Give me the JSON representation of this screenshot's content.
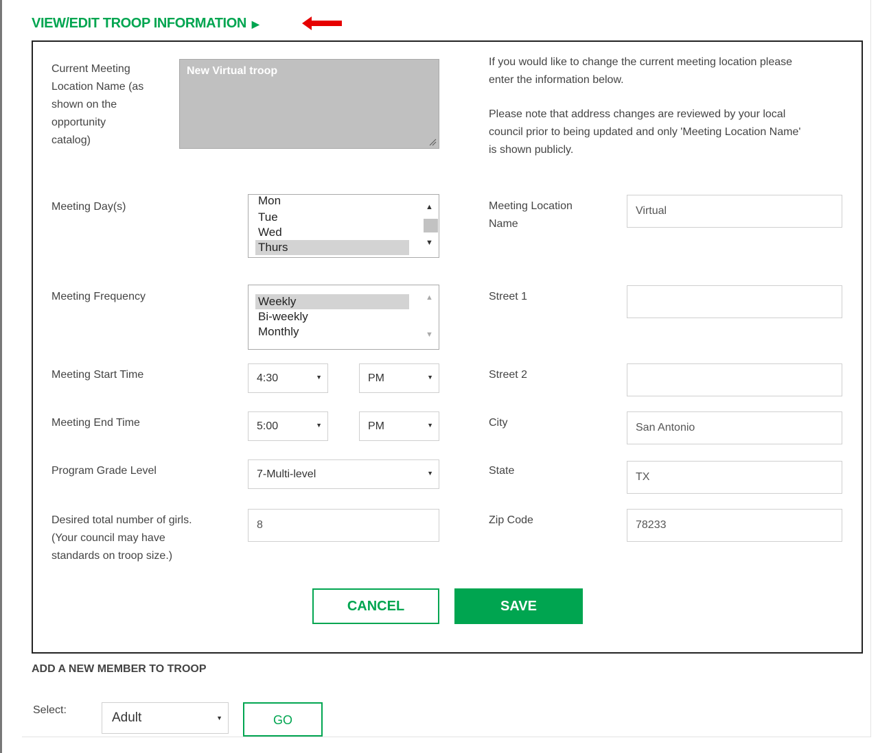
{
  "section": {
    "title": "VIEW/EDIT TROOP INFORMATION",
    "title_icon": "play-triangle-icon",
    "annotation_icon": "red-arrow-icon"
  },
  "current_location": {
    "label_lines": [
      "Current Meeting",
      "Location Name (as",
      "shown on the",
      "opportunity",
      "catalog)"
    ],
    "value": "New Virtual troop"
  },
  "notes": {
    "line1a": "If you would like to change the current meeting location please",
    "line1b": "enter the information below.",
    "line2a": "Please note that address changes are reviewed by your local",
    "line2b": "council prior to being updated and only 'Meeting Location Name'",
    "line2c": "is shown publicly."
  },
  "meeting_days": {
    "label": "Meeting Day(s)",
    "options": [
      "Mon",
      "Tue",
      "Wed",
      "Thurs"
    ],
    "selected": "Thurs"
  },
  "meeting_frequency": {
    "label": "Meeting Frequency",
    "options": [
      "Weekly",
      "Bi-weekly",
      "Monthly"
    ],
    "selected": "Weekly"
  },
  "start_time": {
    "label": "Meeting Start Time",
    "time": "4:30",
    "ampm": "PM"
  },
  "end_time": {
    "label": "Meeting End Time",
    "time": "5:00",
    "ampm": "PM"
  },
  "grade_level": {
    "label": "Program Grade Level",
    "value": "7-Multi-level"
  },
  "girls": {
    "label_lines": [
      "Desired total number of girls.",
      "(Your council may have",
      "standards on troop size.)"
    ],
    "value": "8"
  },
  "address": {
    "location_name_label_lines": [
      "Meeting Location",
      "Name"
    ],
    "location_name": "Virtual",
    "street1_label": "Street 1",
    "street1": "",
    "street2_label": "Street 2",
    "street2": "",
    "city_label": "City",
    "city": "San Antonio",
    "state_label": "State",
    "state": "TX",
    "zip_label": "Zip Code",
    "zip": "78233"
  },
  "buttons": {
    "cancel": "CANCEL",
    "save": "SAVE",
    "go": "GO"
  },
  "add_member": {
    "title": "ADD A NEW MEMBER TO TROOP",
    "select_label": "Select:",
    "select_value": "Adult"
  },
  "colors": {
    "brand_green": "#00a550",
    "annotation_red": "#e60000",
    "readonly_bg": "#c0c0c0"
  }
}
